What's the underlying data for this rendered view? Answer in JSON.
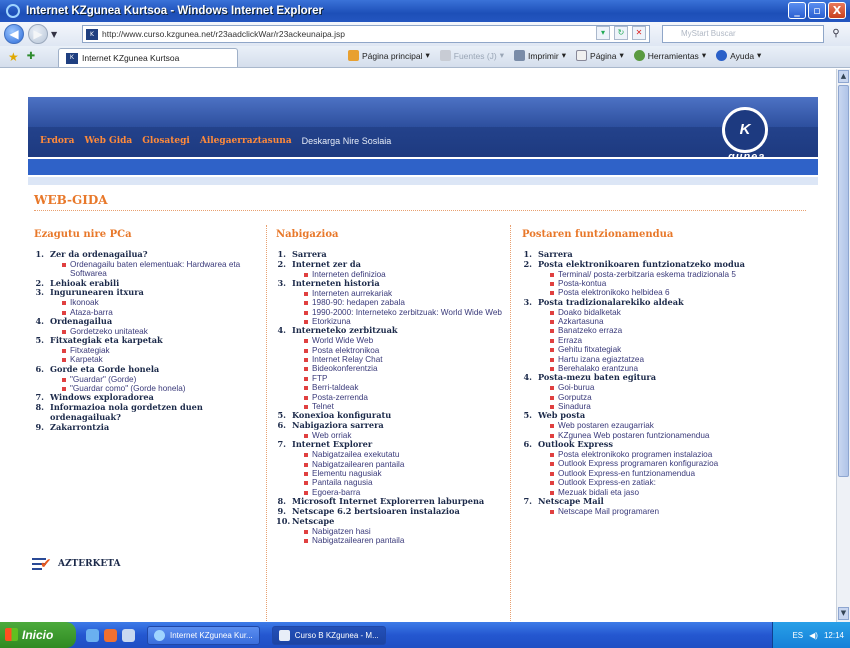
{
  "window": {
    "title": "Internet KZgunea Kurtsoa - Windows Internet Explorer",
    "controls": {
      "minimize": "_",
      "maximize": "▫",
      "close": "X"
    }
  },
  "address_bar": {
    "url": "http://www.curso.kzgunea.net/r23aadclickWar/r23ackeunaipa.jsp",
    "search_placeholder": "MyStart Buscar"
  },
  "tab": {
    "label": "Internet KZgunea Kurtsoa"
  },
  "command_bar": {
    "home": "Página principal",
    "feeds": "Fuentes (J)",
    "print": "Imprimir",
    "page": "Página",
    "tools": "Herramientas",
    "help": "Ayuda"
  },
  "site": {
    "menu": [
      "Erdora",
      "Web Gida",
      "Glosategi",
      "Ailegaerraztasuna"
    ],
    "menu_plain": "Deskarga Nire Soslaia",
    "logo_mark": "K",
    "logo_text": "gunea",
    "heading": "WEB-GIDA",
    "exam_label": "AZTERKETA"
  },
  "columns": [
    {
      "title": "Ezagutu nire PCa",
      "items": [
        {
          "num": "1.",
          "label": "Zer da ordenagailua?",
          "sub": [
            "Ordenagailu baten elementuak: Hardwarea eta Softwarea"
          ]
        },
        {
          "num": "2.",
          "label": "Lehioak erabili",
          "sub": []
        },
        {
          "num": "3.",
          "label": "Ingurunearen itxura",
          "sub": [
            "Ikonoak",
            "Ataza-barra"
          ]
        },
        {
          "num": "4.",
          "label": "Ordenagailua",
          "sub": [
            "Gordetzeko unitateak"
          ]
        },
        {
          "num": "5.",
          "label": "Fitxategiak eta karpetak",
          "sub": [
            "Fitxategiak",
            "Karpetak"
          ]
        },
        {
          "num": "6.",
          "label": "Gorde eta Gorde honela",
          "sub": [
            "\"Guardar\" (Gorde)",
            "\"Guardar como\" (Gorde honela)"
          ]
        },
        {
          "num": "7.",
          "label": "Windows exploradorea",
          "sub": []
        },
        {
          "num": "8.",
          "label": "Informazioa nola gordetzen duen ordenagailuak?",
          "sub": []
        },
        {
          "num": "9.",
          "label": "Zakarrontzia",
          "sub": []
        }
      ]
    },
    {
      "title": "Nabigazioa",
      "items": [
        {
          "num": "1.",
          "label": "Sarrera",
          "sub": []
        },
        {
          "num": "2.",
          "label": "Internet zer da",
          "sub": [
            "Interneten definizioa"
          ]
        },
        {
          "num": "3.",
          "label": "Interneten historia",
          "sub": [
            "Interneten aurrekariak",
            "1980-90: hedapen zabala",
            "1990-2000: Interneteko zerbitzuak: World Wide Web",
            "Etorkizuna"
          ]
        },
        {
          "num": "4.",
          "label": "Interneteko zerbitzuak",
          "sub": [
            "World Wide Web",
            "Posta elektronikoa",
            "Internet Relay Chat",
            "Bideokonferentzia",
            "FTP",
            "Berri-taldeak",
            "Posta-zerrenda",
            "Telnet"
          ]
        },
        {
          "num": "5.",
          "label": "Konexioa konfiguratu",
          "sub": []
        },
        {
          "num": "6.",
          "label": "Nabigaziora sarrera",
          "sub": [
            "Web orriak"
          ]
        },
        {
          "num": "7.",
          "label": "Internet Explorer",
          "sub": [
            "Nabigatzailea exekutatu",
            "Nabigatzailearen pantaila",
            "Elementu nagusiak",
            "Pantaila nagusia",
            "Egoera-barra"
          ]
        },
        {
          "num": "8.",
          "label": "Microsoft Internet Explorerren laburpena",
          "sub": []
        },
        {
          "num": "9.",
          "label": "Netscape 6.2 bertsioaren instalazioa",
          "sub": []
        },
        {
          "num": "10.",
          "label": "Netscape",
          "sub": [
            "Nabigatzen hasi",
            "Nabigatzailearen pantaila"
          ]
        }
      ]
    },
    {
      "title": "Postaren funtzionamendua",
      "items": [
        {
          "num": "1.",
          "label": "Sarrera",
          "sub": []
        },
        {
          "num": "2.",
          "label": "Posta elektronikoaren funtzionatzeko modua",
          "sub": [
            "Terminal/ posta-zerbitzaria eskema tradizionala 5",
            "Posta-kontua",
            "Posta elektronikoko helbidea 6"
          ]
        },
        {
          "num": "3.",
          "label": "Posta tradizionalarekiko aldeak",
          "sub": [
            "Doako bidalketak",
            "Azkartasuna",
            "Banatzeko erraza",
            "Erraza",
            "Gehitu fitxategiak",
            "Hartu izana egiaztatzea",
            "Berehalako erantzuna"
          ]
        },
        {
          "num": "4.",
          "label": "Posta-mezu baten egitura",
          "sub": [
            "Goi-burua",
            "Gorputza",
            "Sinadura"
          ]
        },
        {
          "num": "5.",
          "label": "Web posta",
          "sub": [
            "Web postaren ezaugarriak",
            "KZgunea Web postaren funtzionamendua"
          ]
        },
        {
          "num": "6.",
          "label": "Outlook Express",
          "sub": [
            "Posta elektronikoko programen instalazioa",
            "Outlook Express programaren konfigurazioa",
            "Outlook Express-en funtzionamendua",
            "Outlook Express-en zatiak:",
            "Mezuak bidali eta jaso"
          ]
        },
        {
          "num": "7.",
          "label": "Netscape Mail",
          "sub": [
            "Netscape Mail programaren"
          ]
        }
      ]
    }
  ],
  "taskbar": {
    "start": "Inicio",
    "tasks": [
      "Internet KZgunea Kur...",
      "Curso B KZgunea - M..."
    ],
    "lang": "ES",
    "clock": "12:14"
  }
}
